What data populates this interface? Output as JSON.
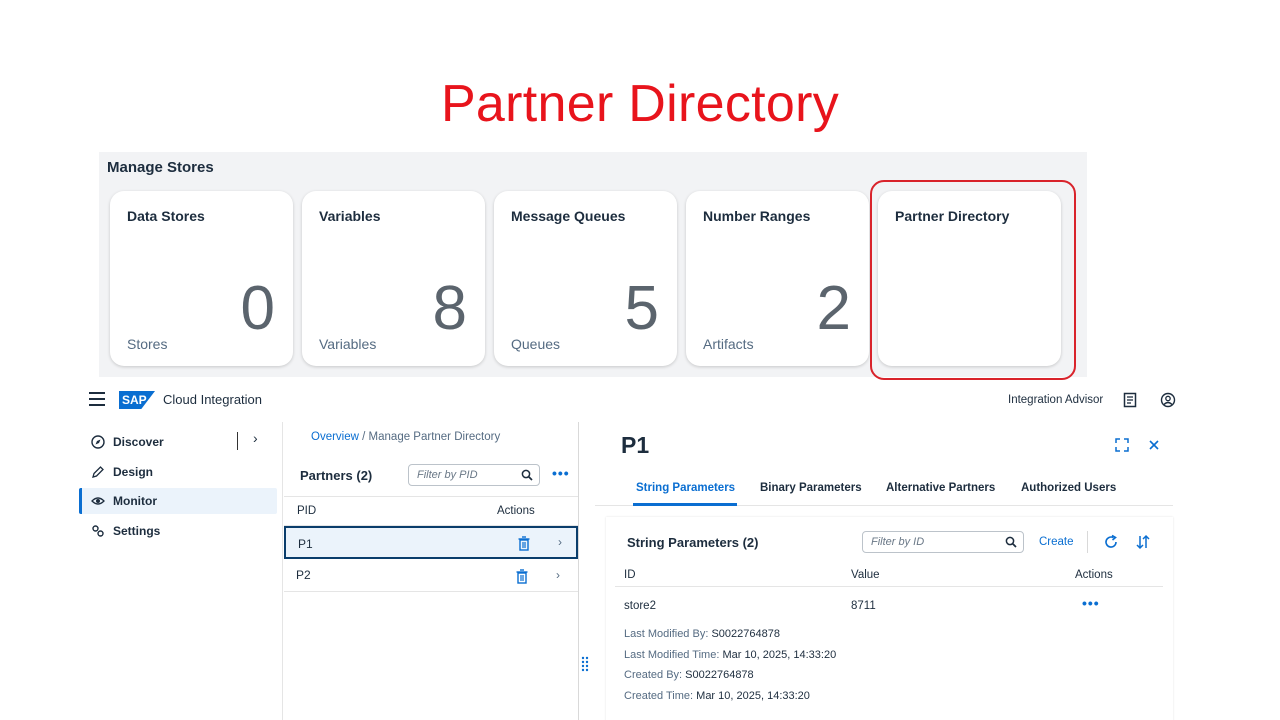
{
  "slide": {
    "title": "Partner Directory"
  },
  "manage_stores": {
    "heading": "Manage Stores",
    "tiles": [
      {
        "title": "Data Stores",
        "number": "0",
        "unit": "Stores"
      },
      {
        "title": "Variables",
        "number": "8",
        "unit": "Variables"
      },
      {
        "title": "Message Queues",
        "number": "5",
        "unit": "Queues"
      },
      {
        "title": "Number Ranges",
        "number": "2",
        "unit": "Artifacts"
      },
      {
        "title": "Partner Directory",
        "number": "",
        "unit": ""
      }
    ],
    "highlight_color": "#d9232b"
  },
  "shellbar": {
    "logo_text": "SAP",
    "app_name": "Cloud Integration",
    "integration_advisor": "Integration Advisor",
    "icons": [
      "menu-icon",
      "document-icon",
      "user-icon"
    ]
  },
  "sidenav": {
    "items": [
      {
        "label": "Discover",
        "icon": "compass-icon"
      },
      {
        "label": "Design",
        "icon": "pencil-icon"
      },
      {
        "label": "Monitor",
        "icon": "eye-icon",
        "active": true
      },
      {
        "label": "Settings",
        "icon": "gears-icon"
      }
    ]
  },
  "list": {
    "breadcrumb": {
      "overview": "Overview",
      "separator": "/",
      "current": "Manage Partner Directory"
    },
    "title": "Partners (2)",
    "filter_placeholder": "Filter by PID",
    "columns": {
      "pid": "PID",
      "actions": "Actions"
    },
    "rows": [
      {
        "pid": "P1",
        "selected": true
      },
      {
        "pid": "P2",
        "selected": false
      }
    ]
  },
  "detail": {
    "title": "P1",
    "tabs": [
      "String Parameters",
      "Binary Parameters",
      "Alternative Partners",
      "Authorized Users"
    ],
    "active_tab": "String Parameters",
    "table": {
      "title": "String Parameters (2)",
      "filter_placeholder": "Filter by ID",
      "create_label": "Create",
      "columns": {
        "id": "ID",
        "value": "Value",
        "actions": "Actions"
      },
      "row": {
        "id": "store2",
        "value": "8711",
        "last_modified_by_label": "Last Modified By:",
        "last_modified_by": "S0022764878",
        "last_modified_time_label": "Last Modified Time:",
        "last_modified_time": "Mar 10, 2025, 14:33:20",
        "created_by_label": "Created By:",
        "created_by": "S0022764878",
        "created_time_label": "Created Time:",
        "created_time": "Mar 10, 2025, 14:33:20"
      }
    }
  },
  "colors": {
    "accent": "#0a6ed1",
    "title_red": "#e8141c",
    "text": "#1d2d3e"
  }
}
